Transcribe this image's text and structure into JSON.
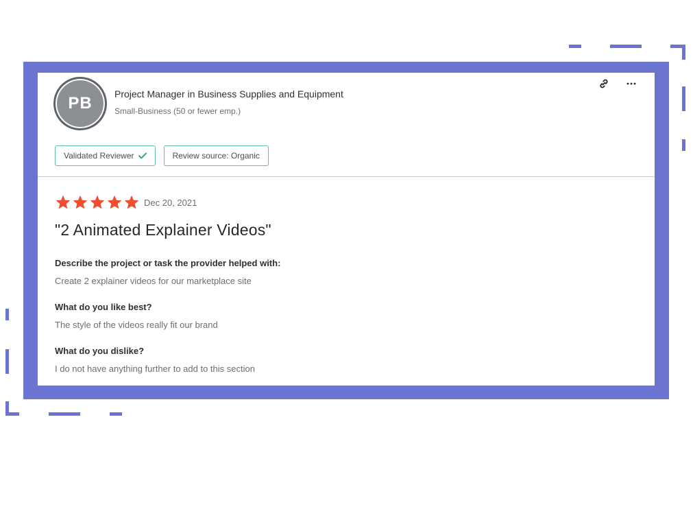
{
  "reviewer": {
    "initials": "PB",
    "title": "Project Manager in Business Supplies and Equipment",
    "company_size": "Small-Business (50 or fewer emp.)"
  },
  "badges": {
    "validated": "Validated Reviewer",
    "source": "Review source: Organic"
  },
  "review": {
    "rating": 5,
    "date": "Dec 20, 2021",
    "title": "\"2 Animated Explainer Videos\"",
    "sections": [
      {
        "question": "Describe the project or task the provider helped with:",
        "answer": "Create 2 explainer videos for our marketplace site"
      },
      {
        "question": "What do you like best?",
        "answer": "The style of the videos really fit our brand"
      },
      {
        "question": "What do you dislike?",
        "answer": "I do not have anything further to add to this section"
      }
    ]
  },
  "icons": {
    "link": "link-icon",
    "more": "more-icon",
    "check": "check-icon",
    "star": "star-icon"
  },
  "colors": {
    "frame": "#6b74d1",
    "star": "#f04e31",
    "badge_border": "#5fbfa7",
    "check": "#3fae8c"
  }
}
